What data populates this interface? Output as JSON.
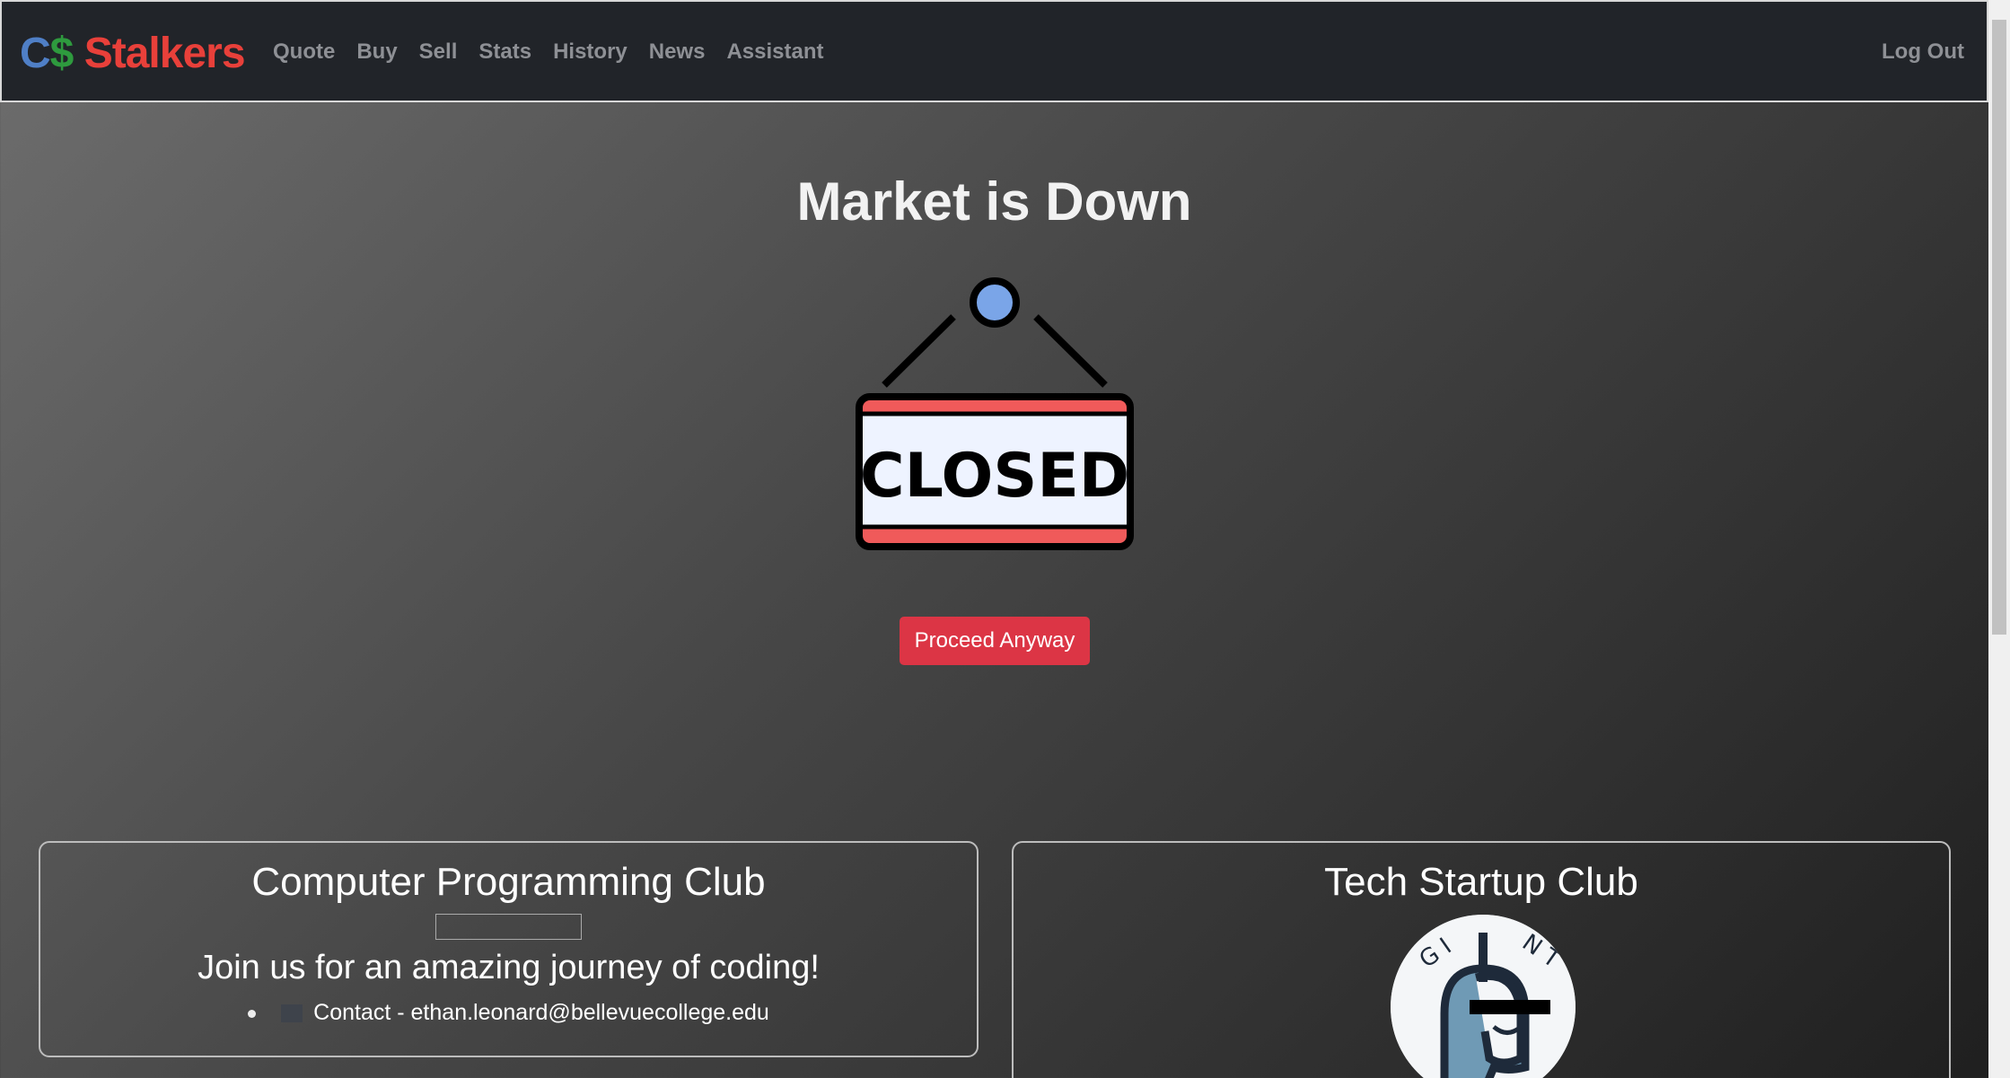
{
  "nav": {
    "logo_c": "C",
    "logo_dollar": "$",
    "logo_name": "Stalkers",
    "links": [
      "Quote",
      "Buy",
      "Sell",
      "Stats",
      "History",
      "News",
      "Assistant"
    ],
    "logout": "Log Out"
  },
  "main": {
    "title": "Market is Down",
    "sign_text": "CLOSED",
    "proceed": "Proceed Anyway"
  },
  "cards": [
    {
      "title": "Computer Programming Club",
      "subtitle": "Join us for an amazing journey of coding!",
      "contact": "Contact - ethan.leonard@bellevuecollege.edu"
    },
    {
      "title": "Tech Startup Club",
      "logo_text": "GIANT"
    }
  ]
}
